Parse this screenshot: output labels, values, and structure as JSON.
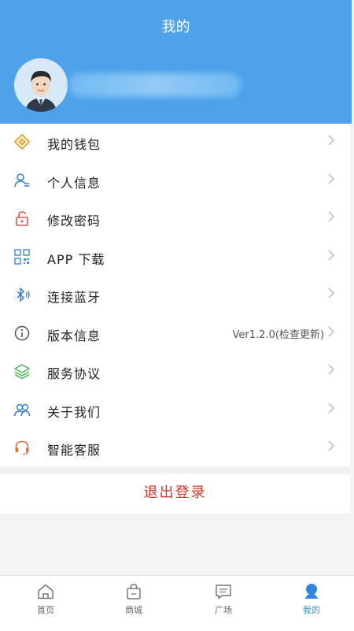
{
  "header": {
    "title": "我的"
  },
  "menu": {
    "items": [
      {
        "label": "我的钱包",
        "icon": "wallet-icon"
      },
      {
        "label": "个人信息",
        "icon": "user-info-icon"
      },
      {
        "label": "修改密码",
        "icon": "lock-icon"
      },
      {
        "label": "APP 下载",
        "icon": "qr-code-icon"
      },
      {
        "label": "连接蓝牙",
        "icon": "bluetooth-icon"
      },
      {
        "label": "版本信息",
        "icon": "info-icon",
        "value": "Ver1.2.0(检查更新)"
      },
      {
        "label": "服务协议",
        "icon": "layers-icon"
      },
      {
        "label": "关于我们",
        "icon": "users-icon"
      },
      {
        "label": "智能客服",
        "icon": "headset-icon"
      }
    ]
  },
  "logout": {
    "label": "退出登录"
  },
  "tabbar": {
    "tabs": [
      {
        "label": "首页",
        "icon": "home-icon"
      },
      {
        "label": "商城",
        "icon": "shopping-bag-icon"
      },
      {
        "label": "广场",
        "icon": "message-icon"
      },
      {
        "label": "我的",
        "icon": "profile-icon",
        "active": true
      }
    ]
  },
  "colors": {
    "header": "#4da2ea",
    "logout": "#d9342b",
    "active_tab": "#3a8fe0"
  }
}
